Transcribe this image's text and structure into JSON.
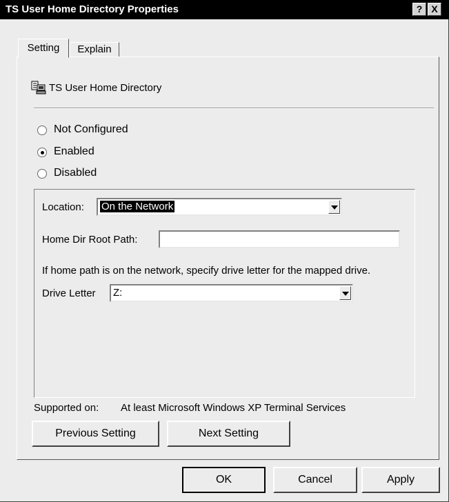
{
  "window": {
    "title": "TS User Home Directory Properties",
    "help_btn": "?",
    "close_btn": "X"
  },
  "tabs": [
    {
      "label": "Setting",
      "active": true
    },
    {
      "label": "Explain",
      "active": false
    }
  ],
  "policy": {
    "icon": "policy-computer-icon",
    "name": "TS User Home Directory"
  },
  "state_options": [
    {
      "label": "Not Configured",
      "selected": false
    },
    {
      "label": "Enabled",
      "selected": true
    },
    {
      "label": "Disabled",
      "selected": false
    }
  ],
  "options": {
    "location_label": "Location:",
    "location_value": "On the Network",
    "home_dir_label": "Home Dir Root Path:",
    "home_dir_value": "",
    "help_text": "If home path is on the network, specify drive letter for the mapped drive.",
    "drive_letter_label": "Drive Letter",
    "drive_letter_value": "Z:"
  },
  "supported": {
    "label": "Supported on:",
    "value": "At least Microsoft Windows XP Terminal Services"
  },
  "nav_buttons": {
    "previous": "Previous Setting",
    "next": "Next Setting"
  },
  "dialog_buttons": {
    "ok": "OK",
    "cancel": "Cancel",
    "apply": "Apply"
  }
}
